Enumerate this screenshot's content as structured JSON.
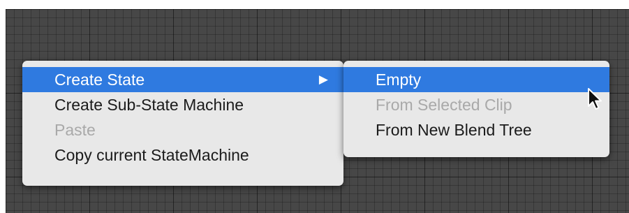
{
  "context_menu": {
    "items": [
      {
        "label": "Create State",
        "state": "highlighted",
        "has_submenu": true,
        "submenu_arrow": "▶"
      },
      {
        "label": "Create Sub-State Machine",
        "state": "normal"
      },
      {
        "label": "Paste",
        "state": "disabled"
      },
      {
        "label": "Copy current StateMachine",
        "state": "normal"
      }
    ]
  },
  "submenu": {
    "items": [
      {
        "label": "Empty",
        "state": "highlighted"
      },
      {
        "label": "From Selected Clip",
        "state": "disabled"
      },
      {
        "label": "From New Blend Tree",
        "state": "normal"
      }
    ]
  },
  "icons": {
    "cursor": "mouse-pointer-icon",
    "submenu_arrow": "triangle-right-icon"
  },
  "colors": {
    "highlight": "#2f7ae0",
    "menu_background": "#e8e8e8",
    "canvas_background": "#474747",
    "disabled_text": "#a9a9a9"
  }
}
